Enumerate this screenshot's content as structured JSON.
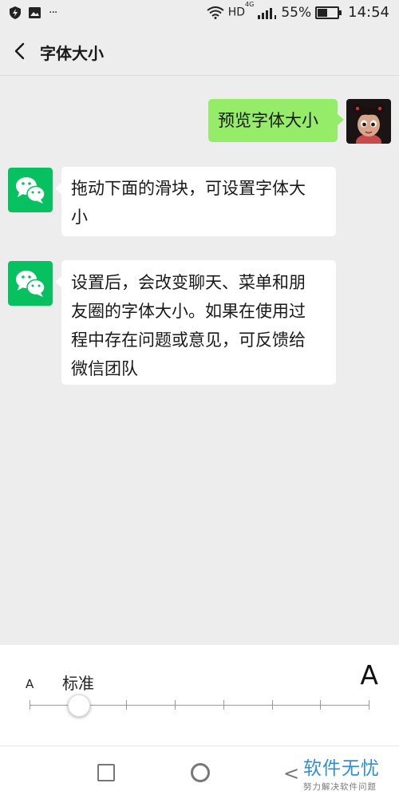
{
  "status_bar": {
    "network": "HD",
    "network_type": "4G",
    "battery": "55%",
    "battery_level": 0.55,
    "time": "14:54",
    "more": "···"
  },
  "header": {
    "title": "字体大小"
  },
  "messages": [
    {
      "side": "right",
      "text": "预览字体大小"
    },
    {
      "side": "left",
      "lines": [
        "拖动下面的滑块，可设置字体大",
        "小"
      ]
    },
    {
      "side": "left",
      "lines": [
        "设置后，会改变聊天、菜单和朋",
        "友圈的字体大小。如果在使用过",
        "程中存在问题或意见，可反馈给",
        "微信团队"
      ]
    }
  ],
  "font_size": {
    "small_label": "A",
    "large_label": "A",
    "current_label": "标准",
    "steps": 8,
    "current_step": 2
  },
  "watermark": {
    "main": "软件无忧",
    "sub": "努力解决软件问题"
  },
  "colors": {
    "wechat_green": "#07c160",
    "bubble_green": "#95ec69",
    "background": "#ededed"
  }
}
